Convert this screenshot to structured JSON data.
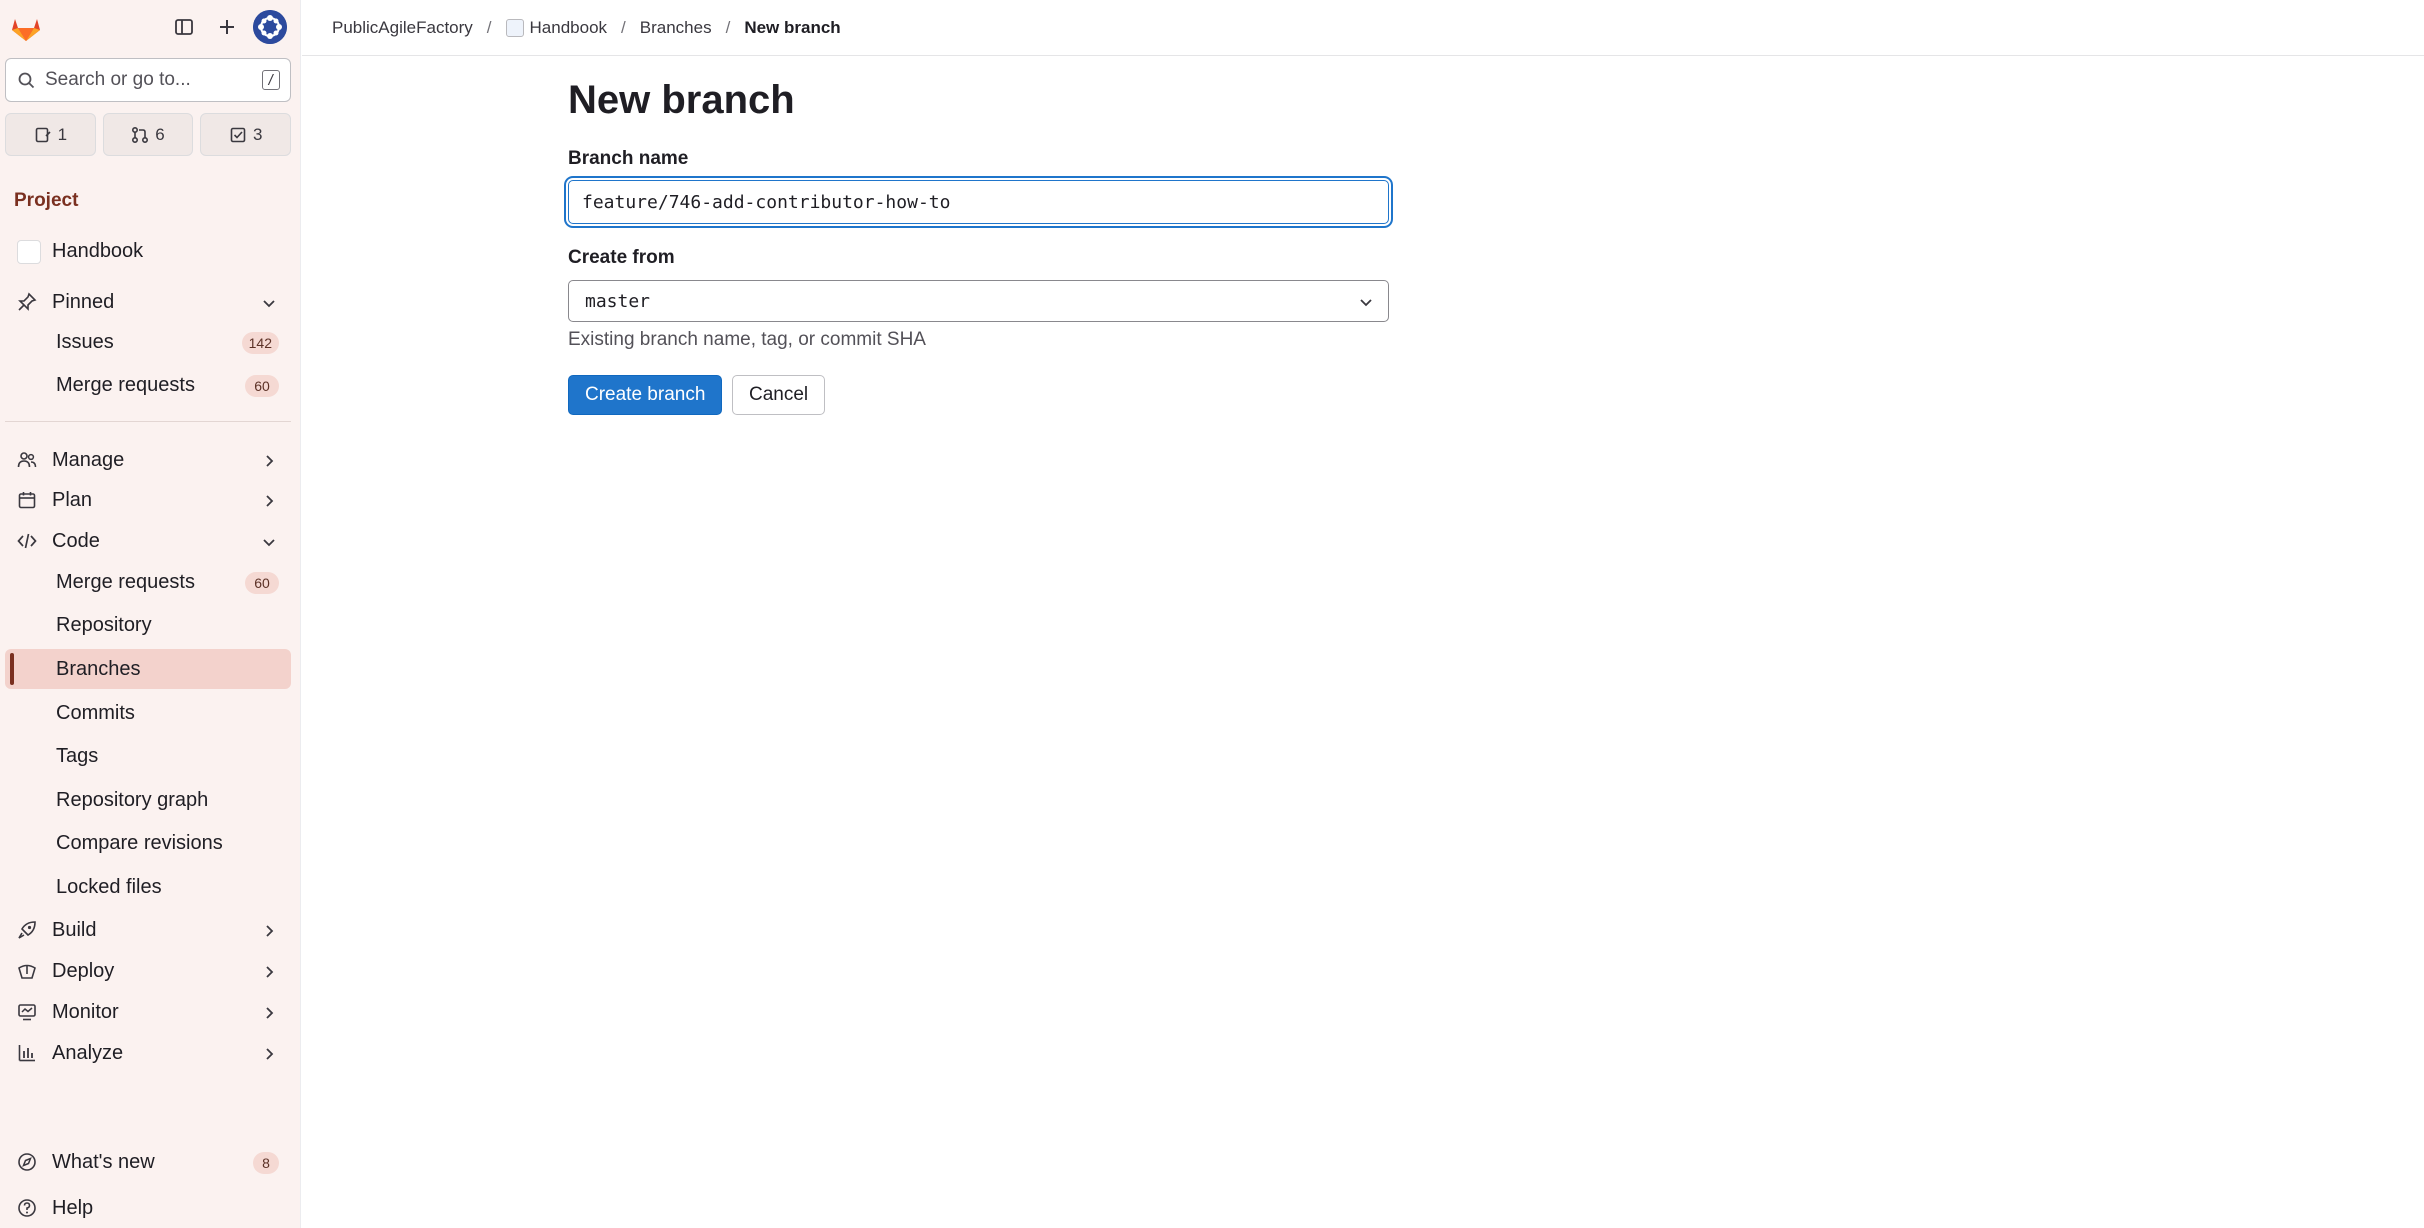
{
  "topbar": {
    "breadcrumbs": [
      {
        "label": "PublicAgileFactory"
      },
      {
        "label": "Handbook"
      },
      {
        "label": "Branches"
      },
      {
        "label": "New branch"
      }
    ]
  },
  "sidebar": {
    "search_placeholder": "Search or go to...",
    "search_shortcut": "/",
    "counts": {
      "issues": "1",
      "merge_requests": "6",
      "todos": "3"
    },
    "section_label": "Project",
    "project_name": "Handbook",
    "pinned": {
      "label": "Pinned",
      "items": [
        {
          "label": "Issues",
          "badge": "142"
        },
        {
          "label": "Merge requests",
          "badge": "60"
        }
      ]
    },
    "groups": {
      "manage": "Manage",
      "plan": "Plan",
      "code": "Code",
      "build": "Build",
      "deploy": "Deploy",
      "monitor": "Monitor",
      "analyze": "Analyze"
    },
    "code_items": [
      {
        "label": "Merge requests",
        "badge": "60"
      },
      {
        "label": "Repository"
      },
      {
        "label": "Branches"
      },
      {
        "label": "Commits"
      },
      {
        "label": "Tags"
      },
      {
        "label": "Repository graph"
      },
      {
        "label": "Compare revisions"
      },
      {
        "label": "Locked files"
      }
    ],
    "whats_new": {
      "label": "What's new",
      "badge": "8"
    },
    "help": "Help"
  },
  "main": {
    "title": "New branch",
    "branch_name_label": "Branch name",
    "branch_name_value": "feature/746-add-contributor-how-to",
    "create_from_label": "Create from",
    "create_from_value": "master",
    "create_from_help": "Existing branch name, tag, or commit SHA",
    "create_button": "Create branch",
    "cancel_button": "Cancel"
  },
  "colors": {
    "primary": "#1f75cb",
    "sidebar_bg": "#fbf2f0",
    "active_item_bg": "#f3d2cc",
    "section_label": "#7a3020"
  }
}
